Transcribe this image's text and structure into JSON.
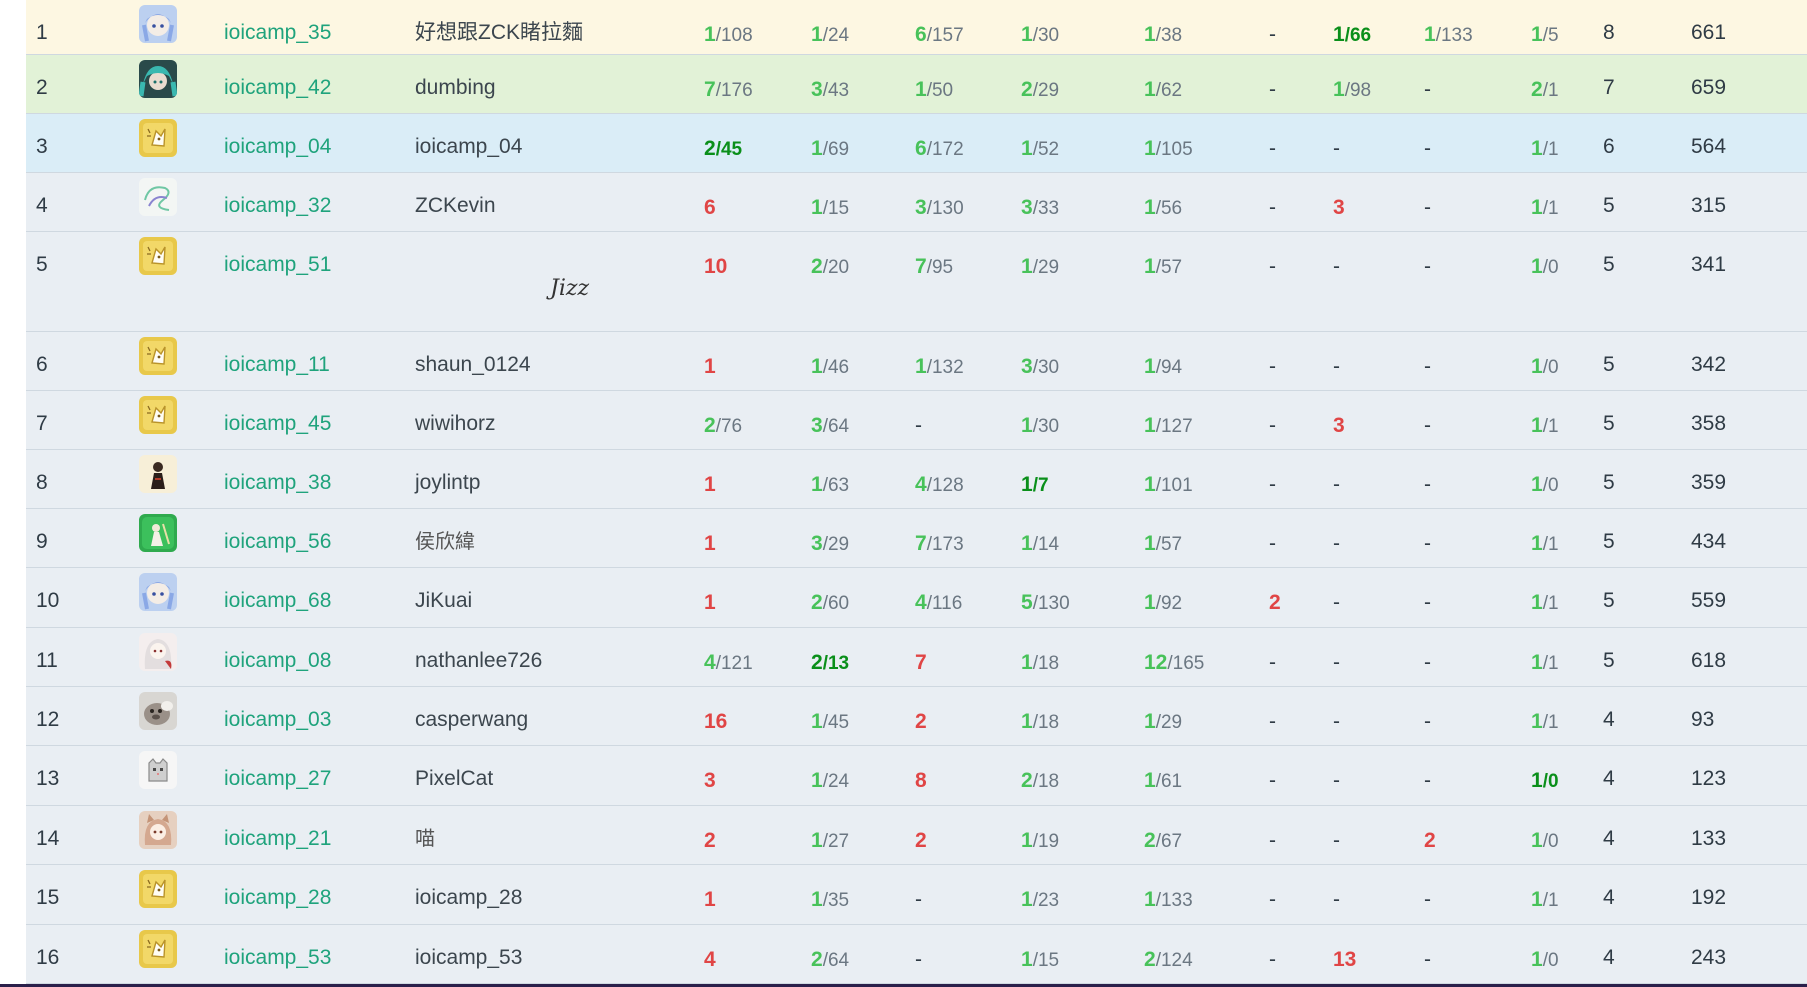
{
  "scoreboard": {
    "rows": [
      {
        "rank": "1",
        "team": "ioicamp_35",
        "nick": "好想跟ZCK睹拉麵",
        "avatar": "anime-girl-blue-avatar",
        "solved": "8",
        "penalty": "661",
        "problems": [
          [
            "1",
            "/108",
            "ac"
          ],
          [
            "1",
            "/24",
            "ac"
          ],
          [
            "6",
            "/157",
            "ac"
          ],
          [
            "1",
            "/30",
            "ac"
          ],
          [
            "1",
            "/38",
            "ac"
          ],
          [
            "-",
            "",
            "none"
          ],
          [
            "1",
            "/66",
            "first"
          ],
          [
            "1",
            "/133",
            "ac"
          ],
          [
            "1",
            "/5",
            "ac"
          ]
        ]
      },
      {
        "rank": "2",
        "team": "ioicamp_42",
        "nick": "dumbing",
        "avatar": "miku-teal-avatar",
        "solved": "7",
        "penalty": "659",
        "problems": [
          [
            "7",
            "/176",
            "ac"
          ],
          [
            "3",
            "/43",
            "ac"
          ],
          [
            "1",
            "/50",
            "ac"
          ],
          [
            "2",
            "/29",
            "ac"
          ],
          [
            "1",
            "/62",
            "ac"
          ],
          [
            "-",
            "",
            "none"
          ],
          [
            "1",
            "/98",
            "ac"
          ],
          [
            "-",
            "",
            "none"
          ],
          [
            "2",
            "/1",
            "ac"
          ]
        ]
      },
      {
        "rank": "3",
        "team": "ioicamp_04",
        "nick": "ioicamp_04",
        "avatar": "default-kitten-avatar",
        "solved": "6",
        "penalty": "564",
        "problems": [
          [
            "2",
            "/45",
            "first"
          ],
          [
            "1",
            "/69",
            "ac"
          ],
          [
            "6",
            "/172",
            "ac"
          ],
          [
            "1",
            "/52",
            "ac"
          ],
          [
            "1",
            "/105",
            "ac"
          ],
          [
            "-",
            "",
            "none"
          ],
          [
            "-",
            "",
            "none"
          ],
          [
            "-",
            "",
            "none"
          ],
          [
            "1",
            "/1",
            "ac"
          ]
        ]
      },
      {
        "rank": "4",
        "team": "ioicamp_32",
        "nick": "ZCKevin",
        "avatar": "scribble-logo-avatar",
        "solved": "5",
        "penalty": "315",
        "problems": [
          [
            "6",
            "",
            "fail"
          ],
          [
            "1",
            "/15",
            "ac"
          ],
          [
            "3",
            "/130",
            "ac"
          ],
          [
            "3",
            "/33",
            "ac"
          ],
          [
            "1",
            "/56",
            "ac"
          ],
          [
            "-",
            "",
            "none"
          ],
          [
            "3",
            "",
            "fail"
          ],
          [
            "-",
            "",
            "none"
          ],
          [
            "1",
            "/1",
            "ac"
          ]
        ]
      },
      {
        "rank": "5",
        "team": "ioicamp_51",
        "nick": "Jizz",
        "avatar": "default-kitten-avatar",
        "solved": "5",
        "penalty": "341",
        "nickStyle": "script",
        "problems": [
          [
            "10",
            "",
            "fail"
          ],
          [
            "2",
            "/20",
            "ac"
          ],
          [
            "7",
            "/95",
            "ac"
          ],
          [
            "1",
            "/29",
            "ac"
          ],
          [
            "1",
            "/57",
            "ac"
          ],
          [
            "-",
            "",
            "none"
          ],
          [
            "-",
            "",
            "none"
          ],
          [
            "-",
            "",
            "none"
          ],
          [
            "1",
            "/0",
            "ac"
          ]
        ]
      },
      {
        "rank": "6",
        "team": "ioicamp_11",
        "nick": "shaun_0124",
        "avatar": "default-kitten-avatar",
        "solved": "5",
        "penalty": "342",
        "problems": [
          [
            "1",
            "",
            "fail"
          ],
          [
            "1",
            "/46",
            "ac"
          ],
          [
            "1",
            "/132",
            "ac"
          ],
          [
            "3",
            "/30",
            "ac"
          ],
          [
            "1",
            "/94",
            "ac"
          ],
          [
            "-",
            "",
            "none"
          ],
          [
            "-",
            "",
            "none"
          ],
          [
            "-",
            "",
            "none"
          ],
          [
            "1",
            "/0",
            "ac"
          ]
        ]
      },
      {
        "rank": "7",
        "team": "ioicamp_45",
        "nick": "wiwihorz",
        "avatar": "default-kitten-avatar",
        "solved": "5",
        "penalty": "358",
        "problems": [
          [
            "2",
            "/76",
            "ac"
          ],
          [
            "3",
            "/64",
            "ac"
          ],
          [
            "-",
            "",
            "none"
          ],
          [
            "1",
            "/30",
            "ac"
          ],
          [
            "1",
            "/127",
            "ac"
          ],
          [
            "-",
            "",
            "none"
          ],
          [
            "3",
            "",
            "fail"
          ],
          [
            "-",
            "",
            "none"
          ],
          [
            "1",
            "/1",
            "ac"
          ]
        ]
      },
      {
        "rank": "8",
        "team": "ioicamp_38",
        "nick": "joylintp",
        "avatar": "dark-character-avatar",
        "solved": "5",
        "penalty": "359",
        "problems": [
          [
            "1",
            "",
            "fail"
          ],
          [
            "1",
            "/63",
            "ac"
          ],
          [
            "4",
            "/128",
            "ac"
          ],
          [
            "1",
            "/7",
            "first"
          ],
          [
            "1",
            "/101",
            "ac"
          ],
          [
            "-",
            "",
            "none"
          ],
          [
            "-",
            "",
            "none"
          ],
          [
            "-",
            "",
            "none"
          ],
          [
            "1",
            "/0",
            "ac"
          ]
        ]
      },
      {
        "rank": "9",
        "team": "ioicamp_56",
        "nick": "侯欣緯",
        "avatar": "green-character-avatar",
        "solved": "5",
        "penalty": "434",
        "nickStyle": "cjk",
        "problems": [
          [
            "1",
            "",
            "fail"
          ],
          [
            "3",
            "/29",
            "ac"
          ],
          [
            "7",
            "/173",
            "ac"
          ],
          [
            "1",
            "/14",
            "ac"
          ],
          [
            "1",
            "/57",
            "ac"
          ],
          [
            "-",
            "",
            "none"
          ],
          [
            "-",
            "",
            "none"
          ],
          [
            "-",
            "",
            "none"
          ],
          [
            "1",
            "/1",
            "ac"
          ]
        ]
      },
      {
        "rank": "10",
        "team": "ioicamp_68",
        "nick": "JiKuai",
        "avatar": "anime-girl-blue-avatar",
        "solved": "5",
        "penalty": "559",
        "problems": [
          [
            "1",
            "",
            "fail"
          ],
          [
            "2",
            "/60",
            "ac"
          ],
          [
            "4",
            "/116",
            "ac"
          ],
          [
            "5",
            "/130",
            "ac"
          ],
          [
            "1",
            "/92",
            "ac"
          ],
          [
            "2",
            "",
            "fail"
          ],
          [
            "-",
            "",
            "none"
          ],
          [
            "-",
            "",
            "none"
          ],
          [
            "1",
            "/1",
            "ac"
          ]
        ]
      },
      {
        "rank": "11",
        "team": "ioicamp_08",
        "nick": "nathanlee726",
        "avatar": "white-hair-girl-avatar",
        "solved": "5",
        "penalty": "618",
        "problems": [
          [
            "4",
            "/121",
            "ac"
          ],
          [
            "2",
            "/13",
            "first"
          ],
          [
            "7",
            "",
            "fail"
          ],
          [
            "1",
            "/18",
            "ac"
          ],
          [
            "12",
            "/165",
            "ac"
          ],
          [
            "-",
            "",
            "none"
          ],
          [
            "-",
            "",
            "none"
          ],
          [
            "-",
            "",
            "none"
          ],
          [
            "1",
            "/1",
            "ac"
          ]
        ]
      },
      {
        "rank": "12",
        "team": "ioicamp_03",
        "nick": "casperwang",
        "avatar": "seal-photo-avatar",
        "solved": "4",
        "penalty": "93",
        "problems": [
          [
            "16",
            "",
            "fail"
          ],
          [
            "1",
            "/45",
            "ac"
          ],
          [
            "2",
            "",
            "fail"
          ],
          [
            "1",
            "/18",
            "ac"
          ],
          [
            "1",
            "/29",
            "ac"
          ],
          [
            "-",
            "",
            "none"
          ],
          [
            "-",
            "",
            "none"
          ],
          [
            "-",
            "",
            "none"
          ],
          [
            "1",
            "/1",
            "ac"
          ]
        ]
      },
      {
        "rank": "13",
        "team": "ioicamp_27",
        "nick": "PixelCat",
        "avatar": "pixel-cat-avatar",
        "solved": "4",
        "penalty": "123",
        "problems": [
          [
            "3",
            "",
            "fail"
          ],
          [
            "1",
            "/24",
            "ac"
          ],
          [
            "8",
            "",
            "fail"
          ],
          [
            "2",
            "/18",
            "ac"
          ],
          [
            "1",
            "/61",
            "ac"
          ],
          [
            "-",
            "",
            "none"
          ],
          [
            "-",
            "",
            "none"
          ],
          [
            "-",
            "",
            "none"
          ],
          [
            "1",
            "/0",
            "first"
          ]
        ]
      },
      {
        "rank": "14",
        "team": "ioicamp_21",
        "nick": "喵",
        "avatar": "cat-girl-avatar",
        "solved": "4",
        "penalty": "133",
        "nickStyle": "cjk",
        "problems": [
          [
            "2",
            "",
            "fail"
          ],
          [
            "1",
            "/27",
            "ac"
          ],
          [
            "2",
            "",
            "fail"
          ],
          [
            "1",
            "/19",
            "ac"
          ],
          [
            "2",
            "/67",
            "ac"
          ],
          [
            "-",
            "",
            "none"
          ],
          [
            "-",
            "",
            "none"
          ],
          [
            "2",
            "",
            "fail"
          ],
          [
            "1",
            "/0",
            "ac"
          ]
        ]
      },
      {
        "rank": "15",
        "team": "ioicamp_28",
        "nick": "ioicamp_28",
        "avatar": "default-kitten-avatar",
        "solved": "4",
        "penalty": "192",
        "problems": [
          [
            "1",
            "",
            "fail"
          ],
          [
            "1",
            "/35",
            "ac"
          ],
          [
            "-",
            "",
            "none"
          ],
          [
            "1",
            "/23",
            "ac"
          ],
          [
            "1",
            "/133",
            "ac"
          ],
          [
            "-",
            "",
            "none"
          ],
          [
            "-",
            "",
            "none"
          ],
          [
            "-",
            "",
            "none"
          ],
          [
            "1",
            "/1",
            "ac"
          ]
        ]
      },
      {
        "rank": "16",
        "team": "ioicamp_53",
        "nick": "ioicamp_53",
        "avatar": "default-kitten-avatar",
        "solved": "4",
        "penalty": "243",
        "problems": [
          [
            "4",
            "",
            "fail"
          ],
          [
            "2",
            "/64",
            "ac"
          ],
          [
            "-",
            "",
            "none"
          ],
          [
            "1",
            "/15",
            "ac"
          ],
          [
            "2",
            "/124",
            "ac"
          ],
          [
            "-",
            "",
            "none"
          ],
          [
            "13",
            "",
            "fail"
          ],
          [
            "-",
            "",
            "none"
          ],
          [
            "1",
            "/0",
            "ac"
          ]
        ]
      }
    ]
  },
  "colors": {
    "accepted": "#48c25a",
    "first_solve": "#0a8f1a",
    "failed": "#e04545",
    "team_link": "#1fa37c",
    "gold_row": "#fdf7e2",
    "silver_row": "#e2f2d7",
    "bronze_row": "#daedf7"
  }
}
